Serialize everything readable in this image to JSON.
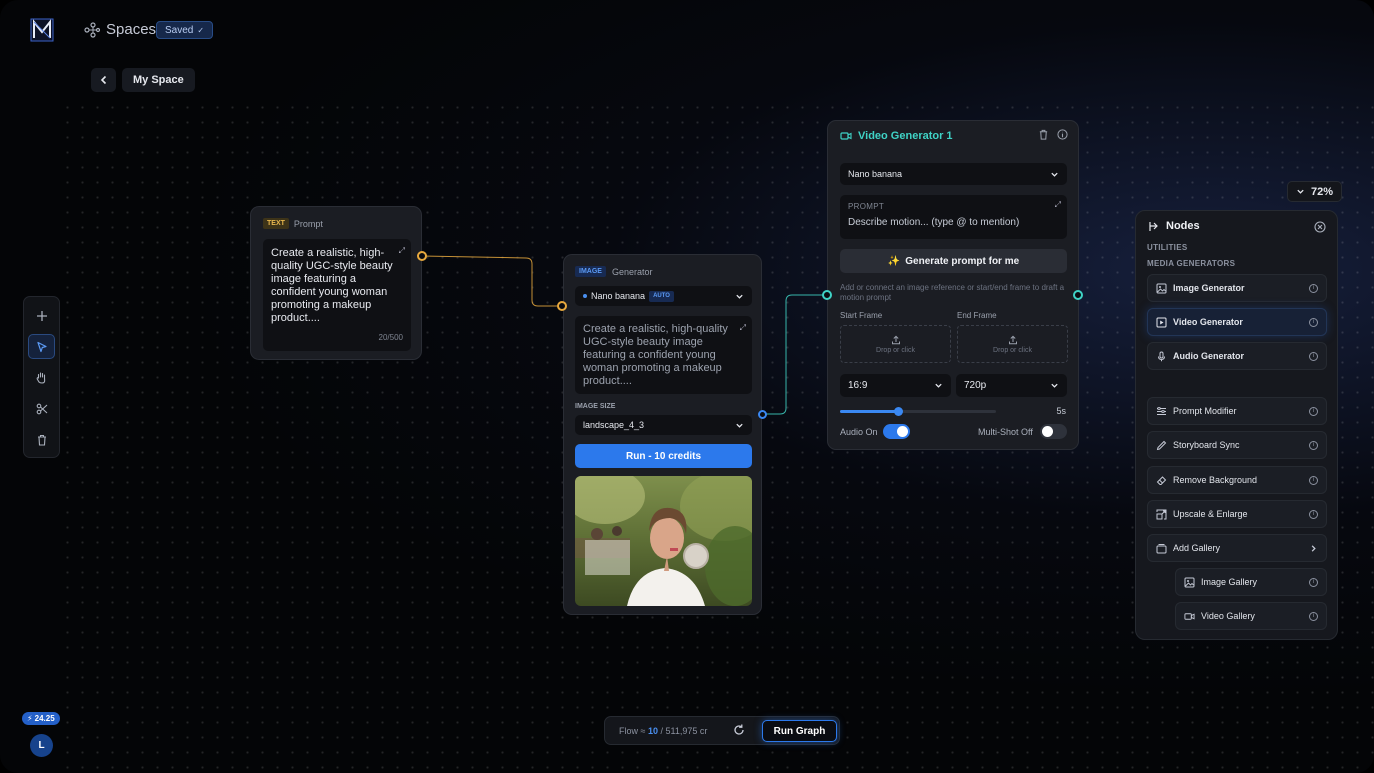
{
  "header": {
    "app_name": "Spaces",
    "saved_label": "Saved",
    "breadcrumb": "My Space"
  },
  "toolbar": {
    "tools": [
      "add",
      "select",
      "hand",
      "cut",
      "delete"
    ],
    "active_tool": "select"
  },
  "user": {
    "credits_badge": "24.25",
    "avatar_initial": "L"
  },
  "text_node": {
    "tag": "TEXT",
    "label": "Prompt",
    "text": "Create a realistic, high-quality UGC-style beauty image featuring a confident young woman promoting a makeup product....",
    "counter": "20/500"
  },
  "image_node": {
    "tag": "IMAGE",
    "label": "Generator",
    "model": "Nano banana",
    "model_badge": "AUTO",
    "prompt": "Create a realistic, high-quality UGC-style beauty image featuring a confident young woman promoting a makeup product....",
    "size_label": "IMAGE SIZE",
    "size_value": "landscape_4_3",
    "run_label": "Run - 10 credits"
  },
  "video_node": {
    "title": "Video Generator 1",
    "model": "Nano banana",
    "prompt_label": "PROMPT",
    "prompt_placeholder": "Describe motion... (type @ to mention)",
    "generate_label": "Generate prompt for me",
    "hint": "Add or connect an image reference or start/end frame to draft a motion prompt",
    "start_frame_label": "Start Frame",
    "end_frame_label": "End Frame",
    "drop_text": "Drop or click",
    "aspect_ratio": "16:9",
    "resolution": "720p",
    "duration_label": "5s",
    "duration_fraction": 0.37,
    "audio_label": "Audio On",
    "audio_on": true,
    "multishot_label": "Multi-Shot Off",
    "multishot_on": false
  },
  "zoom": {
    "label": "72%"
  },
  "nodes_panel": {
    "title": "Nodes",
    "section_utilities": "UTILITIES",
    "section_media": "MEDIA GENERATORS",
    "media_items": [
      {
        "label": "Image Generator",
        "icon": "image-icon"
      },
      {
        "label": "Video Generator",
        "icon": "video-icon",
        "selected": true
      },
      {
        "label": "Audio Generator",
        "icon": "mic-icon"
      }
    ],
    "utility_items": [
      {
        "label": "Prompt Modifier",
        "icon": "sliders-icon"
      },
      {
        "label": "Storyboard Sync",
        "icon": "pen-icon"
      },
      {
        "label": "Remove Background",
        "icon": "eraser-icon"
      },
      {
        "label": "Upscale & Enlarge",
        "icon": "upscale-icon"
      },
      {
        "label": "Add Gallery",
        "icon": "gallery-icon"
      }
    ],
    "gallery_items": [
      {
        "label": "Image Gallery",
        "icon": "image-icon"
      },
      {
        "label": "Video Gallery",
        "icon": "video-icon"
      }
    ]
  },
  "flow": {
    "prefix": "Flow ≈ ",
    "count": "10",
    "total": " / 511,975 cr",
    "run_graph_label": "Run Graph"
  },
  "colors": {
    "accent_blue": "#2c79ec",
    "text_port": "#e8a93e",
    "video_port": "#3fd3c6"
  }
}
